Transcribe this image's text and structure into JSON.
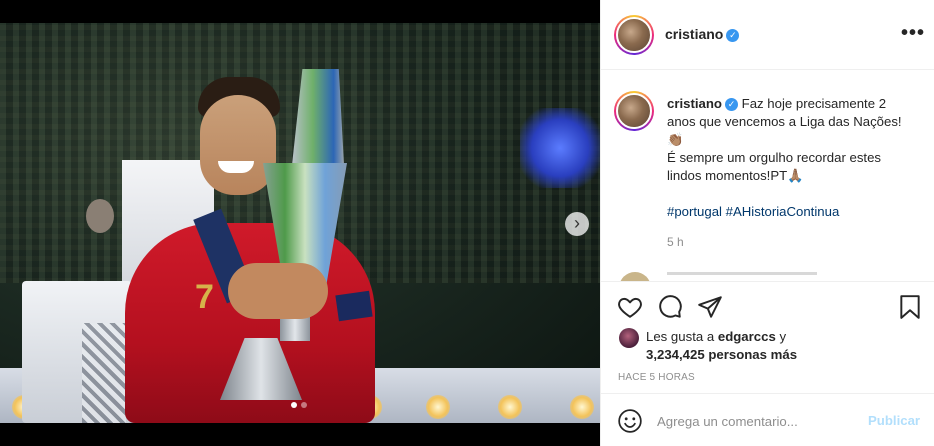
{
  "post": {
    "username": "cristiano",
    "verified": true,
    "caption": {
      "text": "Faz hoje precisamente 2 anos que vencemos a Liga das Nações! 👏🏽 É sempre um orgulho recordar estes lindos momentos!🇵🇹🙏🏽",
      "line1": "Faz hoje precisamente 2 anos que vencemos a Liga das Nações! 👏🏽",
      "line2": "É sempre um orgulho recordar estes lindos momentos!PT🙏🏽",
      "hashtags": "#portugal #AHistoriaContinua",
      "relative_time": "5 h"
    },
    "likes": {
      "prefix": "Les gusta a",
      "liker": "edgarccs",
      "suffix": "y",
      "count_line": "3,234,425 personas más"
    },
    "timestamp": "HACE 5 HORAS",
    "carousel": {
      "current": 1,
      "total": 2
    },
    "photo": {
      "jersey_number": "7"
    }
  },
  "comment": {
    "placeholder": "Agrega un comentario...",
    "post_label": "Publicar"
  },
  "icons": {
    "like": "heart-icon",
    "comment": "comment-icon",
    "share": "share-icon",
    "save": "bookmark-icon",
    "emoji": "emoji-icon",
    "more": "more-options-icon",
    "next": "chevron-right-icon"
  },
  "colors": {
    "verified": "#3897f0",
    "hashtag": "#00376b",
    "post_button_disabled": "#b2dffc",
    "secondary_text": "#8e8e8e"
  },
  "symbols": {
    "more": "•••",
    "verified_check": "✓",
    "next_arrow": "›"
  }
}
